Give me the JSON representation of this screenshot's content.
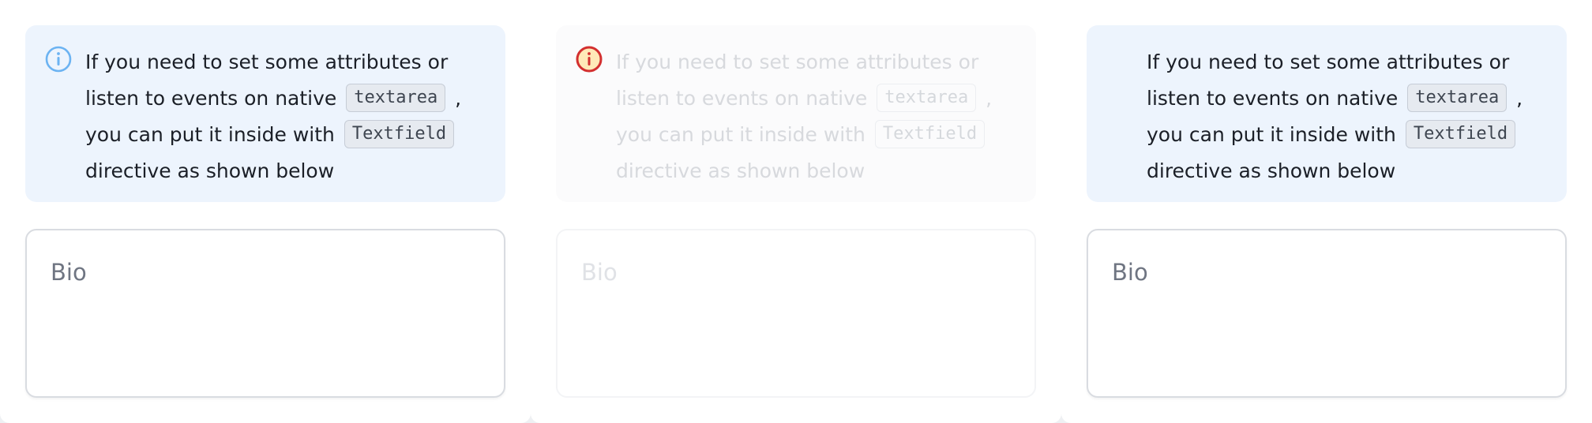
{
  "variants": [
    {
      "icon": "info-icon",
      "icon_color": "#6cb3f2",
      "alert": {
        "line1": "If you need to set some attributes or listen to events on native",
        "code1": "textarea",
        "line2": ", you can put it inside with",
        "code2": "Textfield",
        "line3": "directive as shown below"
      },
      "textarea": {
        "placeholder": "Bio",
        "value": ""
      }
    },
    {
      "icon": "info-warning-icon",
      "icon_color": "#d32f2f",
      "state": "disabled",
      "alert": {
        "line1": "If you need to set some attributes or listen to events on native",
        "code1": "textarea",
        "line2": ", you can put it inside with",
        "code2": "Textfield",
        "line3": "directive as shown below"
      },
      "textarea": {
        "placeholder": "Bio",
        "value": ""
      }
    },
    {
      "icon": "none",
      "alert": {
        "line1": "If you need to set some attributes or listen to events on native",
        "code1": "textarea",
        "line2": ", you can put it inside with",
        "code2": "Textfield",
        "line3": "directive as shown below"
      },
      "textarea": {
        "placeholder": "Bio",
        "value": ""
      }
    }
  ],
  "colors": {
    "alert_background": "#edf4fd",
    "page_background": "#ffffff",
    "text": "#1b1f27",
    "placeholder": "#6f7582"
  }
}
